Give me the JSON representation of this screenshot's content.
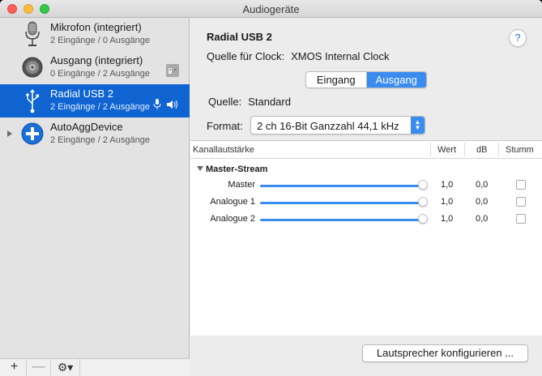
{
  "window": {
    "title": "Audiogeräte"
  },
  "sidebar": {
    "devices": [
      {
        "name": "Mikrofon (integriert)",
        "sub": "2 Eingänge / 0 Ausgänge",
        "icon": "microphone-icon"
      },
      {
        "name": "Ausgang (integriert)",
        "sub": "0 Eingänge / 2 Ausgänge",
        "icon": "speaker-icon"
      },
      {
        "name": "Radial USB 2",
        "sub": "2 Eingänge / 2 Ausgänge",
        "icon": "usb-icon",
        "selected": true
      },
      {
        "name": "AutoAggDevice",
        "sub": "2 Eingänge / 2 Ausgänge",
        "icon": "aggregate-plus-icon"
      }
    ],
    "footer": {
      "add": "+",
      "remove": "—",
      "gear": "⚙▾"
    }
  },
  "main": {
    "device_title": "Radial USB 2",
    "help": "?",
    "clock_label": "Quelle für Clock:",
    "clock_value": "XMOS Internal Clock",
    "tabs": [
      {
        "label": "Eingang",
        "active": false
      },
      {
        "label": "Ausgang",
        "active": true
      }
    ],
    "source_label": "Quelle:",
    "source_value": "Standard",
    "format_label": "Format:",
    "format_value": "2 ch 16-Bit Ganzzahl 44,1 kHz",
    "table": {
      "headers": {
        "volume": "Kanallautstärke",
        "value": "Wert",
        "db": "dB",
        "mute": "Stumm"
      },
      "group": "Master-Stream",
      "rows": [
        {
          "label": "Master",
          "value": "1,0",
          "db": "0,0",
          "level": 1.0,
          "muted": false
        },
        {
          "label": "Analogue 1",
          "value": "1,0",
          "db": "0,0",
          "level": 1.0,
          "muted": false
        },
        {
          "label": "Analogue 2",
          "value": "1,0",
          "db": "0,0",
          "level": 1.0,
          "muted": false
        }
      ]
    },
    "configure_button": "Lautsprecher konfigurieren ..."
  },
  "colors": {
    "accent": "#3a8cf0",
    "selection": "#0f64d2"
  }
}
